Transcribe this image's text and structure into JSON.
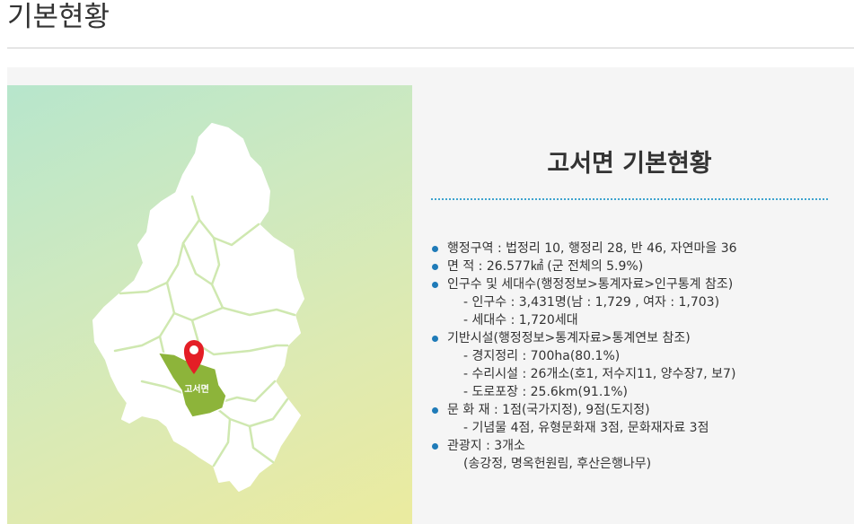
{
  "page": {
    "title": "기본현황"
  },
  "map": {
    "marker_label": "고서면",
    "marker_icon": "map-pin-icon"
  },
  "info": {
    "heading": "고서면 기본현황",
    "items": [
      {
        "text": "행정구역 : 법정리 10, 행정리 28, 반 46, 자연마을 36",
        "subs": []
      },
      {
        "text": "면 적 : 26.577㎢ (군 전체의 5.9%)",
        "subs": []
      },
      {
        "text": "인구수 및 세대수(행정정보>통계자료>인구통계 참조)",
        "subs": [
          "- 인구수 : 3,431명(남 : 1,729 , 여자 : 1,703)",
          "- 세대수 : 1,720세대"
        ]
      },
      {
        "text": "기반시설(행정정보>통계자료>통계연보 참조)",
        "subs": [
          "- 경지정리 : 700ha(80.1%)",
          "- 수리시설 : 26개소(호1, 저수지11, 양수장7, 보7)",
          "- 도로포장 : 25.6km(91.1%)"
        ]
      },
      {
        "text": "문 화 재 : 1점(국가지정), 9점(도지정)",
        "subs": [
          "- 기념물 4점, 유형문화재 3점, 문화재자료 3점"
        ]
      },
      {
        "text": "관광지 : 3개소",
        "subs": [
          "(송강정, 명옥헌원림, 후산은행나무)"
        ]
      }
    ]
  },
  "colors": {
    "accent_blue": "#1f7bb8",
    "highlight_green": "#8db43a",
    "marker_red": "#e41e26"
  }
}
